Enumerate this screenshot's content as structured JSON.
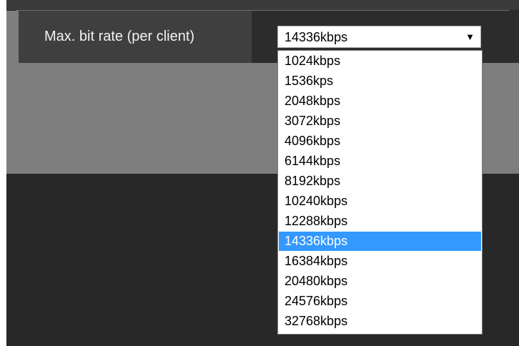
{
  "setting": {
    "label": "Max. bit rate (per client)",
    "selected_value": "14336kbps",
    "arrow_glyph": "▼"
  },
  "dropdown": {
    "options": [
      "1024kbps",
      "1536kps",
      "2048kbps",
      "3072kbps",
      "4096kbps",
      "6144kbps",
      "8192kbps",
      "10240kbps",
      "12288kbps",
      "14336kbps",
      "16384kbps",
      "20480kbps",
      "24576kbps",
      "32768kbps"
    ],
    "selected_index": 9,
    "highlight_color": "#3399ff"
  }
}
